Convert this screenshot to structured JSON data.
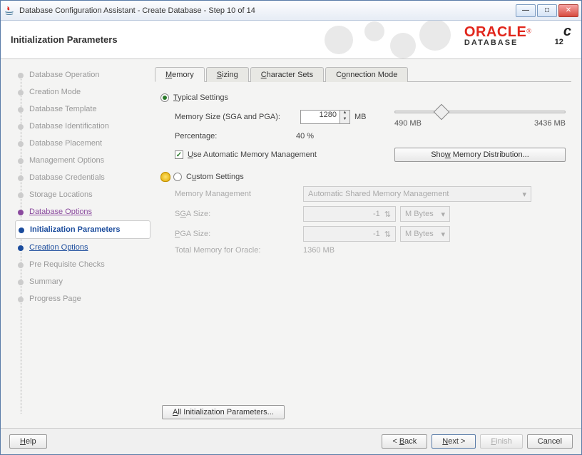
{
  "window": {
    "title": "Database Configuration Assistant - Create Database - Step 10 of 14"
  },
  "header": {
    "title": "Initialization Parameters",
    "brand_top": "ORACLE",
    "brand_bottom": "DATABASE",
    "brand_version": "12",
    "brand_suffix": "c"
  },
  "nav": {
    "steps": [
      "Database Operation",
      "Creation Mode",
      "Database Template",
      "Database Identification",
      "Database Placement",
      "Management Options",
      "Database Credentials",
      "Storage Locations",
      "Database Options",
      "Initialization Parameters",
      "Creation Options",
      "Pre Requisite Checks",
      "Summary",
      "Progress Page"
    ]
  },
  "tabs": {
    "memory": "Memory",
    "sizing": "Sizing",
    "charsets": "Character Sets",
    "connmode": "Connection Mode"
  },
  "memory": {
    "typical_label": "Typical Settings",
    "memsize_label": "Memory Size (SGA and PGA):",
    "memsize_value": "1280",
    "memsize_unit": "MB",
    "percentage_label": "Percentage:",
    "percentage_value": "40 %",
    "slider_min": "490 MB",
    "slider_max": "3436 MB",
    "amm_label": "Use Automatic Memory Management",
    "show_dist_btn": "Show Memory Distribution...",
    "custom_label": "Custom Settings",
    "mm_label": "Memory Management",
    "mm_value": "Automatic Shared Memory Management",
    "sga_label": "SGA Size:",
    "sga_value": "-1",
    "pga_label": "PGA Size:",
    "pga_value": "-1",
    "unit_sel": "M Bytes",
    "total_label": "Total Memory for Oracle:",
    "total_value": "1360 MB",
    "all_params_btn": "All Initialization Parameters..."
  },
  "footer": {
    "help": "Help",
    "back": "< Back",
    "next": "Next >",
    "finish": "Finish",
    "cancel": "Cancel"
  }
}
